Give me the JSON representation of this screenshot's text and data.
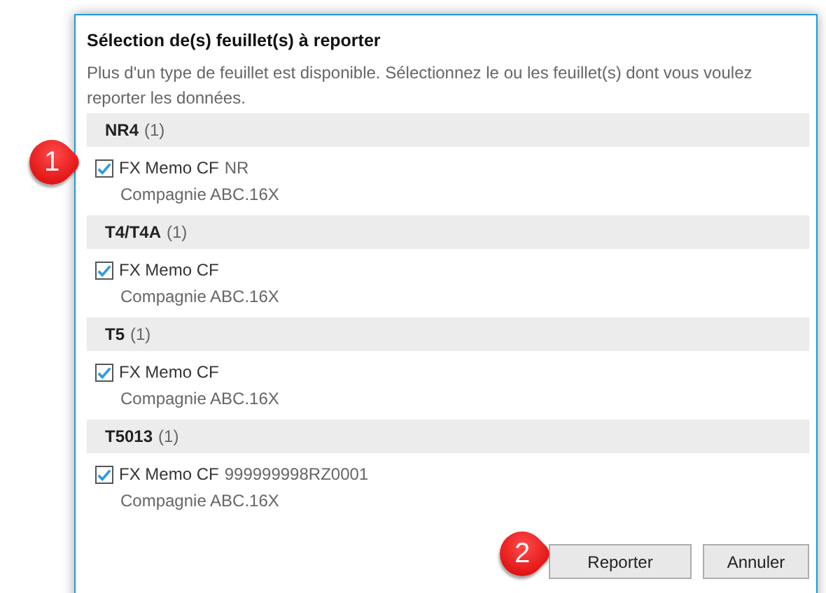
{
  "dialog": {
    "title": "Sélection de(s) feuillet(s) à reporter",
    "description": "Plus d'un type de feuillet est disponible. Sélectionnez le ou les feuillet(s) dont vous voulez reporter les données.",
    "groups": [
      {
        "name": "NR4",
        "count": "(1)",
        "items": [
          {
            "label": "FX Memo CF",
            "suffix": "NR",
            "company": "Compagnie ABC.16X",
            "checked": true
          }
        ]
      },
      {
        "name": "T4/T4A",
        "count": "(1)",
        "items": [
          {
            "label": "FX Memo CF",
            "company": "Compagnie ABC.16X",
            "checked": true
          }
        ]
      },
      {
        "name": "T5",
        "count": "(1)",
        "items": [
          {
            "label": "FX Memo CF",
            "company": "Compagnie ABC.16X",
            "checked": true
          }
        ]
      },
      {
        "name": "T5013",
        "count": "(1)",
        "items": [
          {
            "label": "FX Memo CF",
            "suffix": "999999998RZ0001",
            "company": "Compagnie ABC.16X",
            "checked": true
          }
        ]
      }
    ],
    "buttons": [
      "Reporter",
      "Annuler"
    ]
  },
  "callouts": [
    "1",
    "2"
  ]
}
